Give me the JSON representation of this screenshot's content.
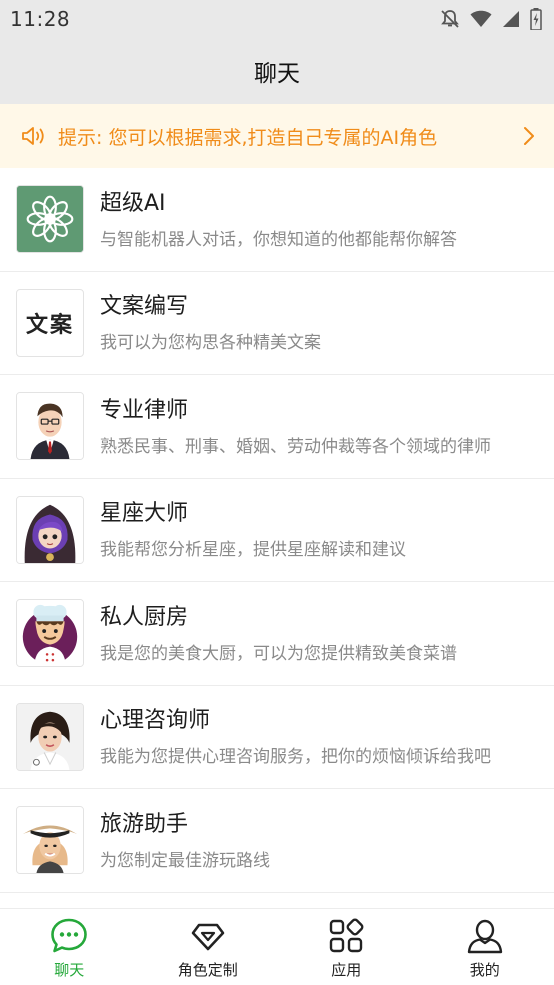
{
  "status_bar": {
    "time": "11:28",
    "icons": [
      "notifications-off-icon",
      "wifi-icon",
      "signal-icon",
      "battery-charging-icon"
    ]
  },
  "header": {
    "title": "聊天"
  },
  "notice": {
    "icon": "speaker-icon",
    "text": "提示: 您可以根据需求,打造自己专属的AI角色",
    "color": "#f08c1a"
  },
  "roles": [
    {
      "name": "超级AI",
      "desc": "与智能机器人对话，你想知道的他都能帮你解答",
      "avatar": "flower-logo-icon"
    },
    {
      "name": "文案编写",
      "desc": "我可以为您构思各种精美文案",
      "avatar": "calligraphy-wenan-icon",
      "avatar_text": "文案"
    },
    {
      "name": "专业律师",
      "desc": "熟悉民事、刑事、婚姻、劳动仲裁等各个领域的律师",
      "avatar": "lawyer-avatar"
    },
    {
      "name": "星座大师",
      "desc": "我能帮您分析星座，提供星座解读和建议",
      "avatar": "astrologer-avatar"
    },
    {
      "name": "私人厨房",
      "desc": "我是您的美食大厨，可以为您提供精致美食菜谱",
      "avatar": "chef-avatar"
    },
    {
      "name": "心理咨询师",
      "desc": "我能为您提供心理咨询服务，把你的烦恼倾诉给我吧",
      "avatar": "counselor-avatar"
    },
    {
      "name": "旅游助手",
      "desc": "为您制定最佳游玩路线",
      "avatar": "traveler-avatar"
    }
  ],
  "bottom_nav": [
    {
      "label": "聊天",
      "icon": "chat-bubble-icon",
      "active": true
    },
    {
      "label": "角色定制",
      "icon": "diamond-icon",
      "active": false
    },
    {
      "label": "应用",
      "icon": "apps-grid-icon",
      "active": false
    },
    {
      "label": "我的",
      "icon": "user-icon",
      "active": false
    }
  ],
  "colors": {
    "accent": "#25a83a",
    "notice_bg": "#fff8e8",
    "header_bg": "#e9e9e9"
  }
}
